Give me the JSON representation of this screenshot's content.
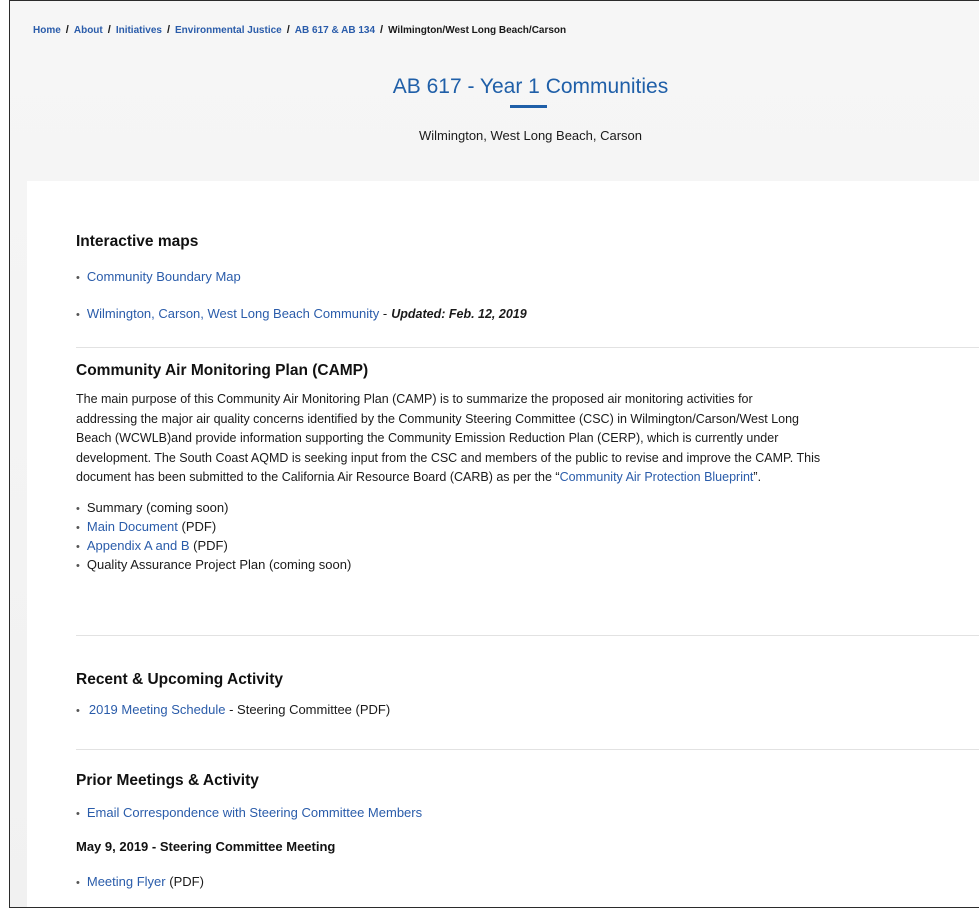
{
  "breadcrumb": {
    "items": [
      "Home",
      "About",
      "Initiatives",
      "Environmental Justice",
      "AB 617 & AB 134"
    ],
    "current": "Wilmington/West Long Beach/Carson",
    "separator": "/"
  },
  "hero": {
    "title": "AB 617 - Year 1 Communities",
    "subtitle": "Wilmington, West Long Beach, Carson"
  },
  "maps": {
    "heading": "Interactive maps",
    "items": [
      "Community Boundary Map",
      "Wilmington, Carson, West Long Beach Community"
    ],
    "updated_note": "Updated: Feb. 12, 2019",
    "separator": "-"
  },
  "camp": {
    "heading": "Community Air Monitoring Plan (CAMP)",
    "paragraph_line1": "The main purpose of this Community Air Monitoring Plan (CAMP) is to summarize the proposed air monitoring activities for",
    "paragraph_line2": "addressing the major air quality concerns identified by the Community Steering Committee (CSC) in Wilmington/Carson/West Long",
    "paragraph_line3": "Beach (WCWLB)and provide information supporting the Community Emission Reduction Plan (CERP), which is currently under",
    "paragraph_line4": "development. The South Coast AQMD is seeking input from the CSC and members of the public to revise and improve the CAMP. This",
    "paragraph_line5_pre": "document has been submitted to the California Air Resource Board (CARB) as per the “",
    "paragraph_link": "Community Air Protection Blueprint",
    "paragraph_line5_post": "”.",
    "items": {
      "summary": "Summary (coming soon)",
      "main_document": "Main Document",
      "appendix": "Appendix A and B",
      "pdf_suffix": "(PDF)",
      "qapp": "Quality Assurance Project Plan (coming soon)"
    }
  },
  "recent": {
    "heading": "Recent & Upcoming Activity",
    "link": "2019 Meeting Schedule",
    "suffix": "- Steering Committee (PDF)"
  },
  "prior": {
    "heading": "Prior Meetings & Activity",
    "email_link": "Email Correspondence with Steering Committee Members",
    "meeting_heading": "May 9, 2019 - Steering Committee Meeting",
    "flyer_link": "Meeting Flyer",
    "flyer_suffix": "(PDF)"
  },
  "colors": {
    "link": "#2a5caa",
    "title": "#1f5fa8"
  }
}
